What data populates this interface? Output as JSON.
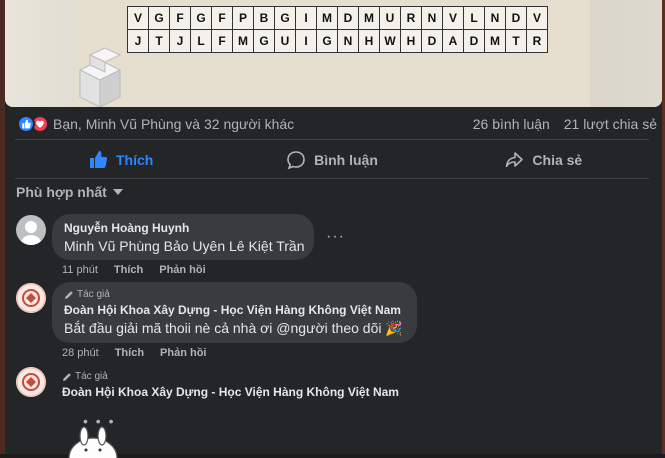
{
  "post": {
    "puzzle_rows": [
      [
        "V",
        "G",
        "F",
        "G",
        "F",
        "P",
        "B",
        "G",
        "I",
        "M",
        "D",
        "M",
        "U",
        "R",
        "N",
        "V",
        "L",
        "N",
        "D",
        "V"
      ],
      [
        "J",
        "T",
        "J",
        "L",
        "F",
        "M",
        "G",
        "U",
        "I",
        "G",
        "N",
        "H",
        "W",
        "H",
        "D",
        "A",
        "D",
        "M",
        "T",
        "R"
      ]
    ]
  },
  "reactions": {
    "summary": "Bạn, Minh Vũ Phùng và 32 người khác",
    "comments_count": "26 bình luận",
    "shares_count": "21 lượt chia sẻ",
    "icons": [
      "like-icon",
      "love-icon"
    ]
  },
  "actions": {
    "like_label": "Thích",
    "comment_label": "Bình luận",
    "share_label": "Chia sẻ",
    "like_active_color": "#2d88ff"
  },
  "sort": {
    "label": "Phù hợp nhất"
  },
  "comments": [
    {
      "author": "Nguyễn Hoàng Huynh",
      "text": "Minh Vũ Phùng Bảo Uyên Lê Kiệt Trần",
      "time": "11 phút",
      "like_label": "Thích",
      "reply_label": "Phản hồi",
      "more": "···"
    },
    {
      "badge": "Tác giả",
      "author": "Đoàn Hội Khoa Xây Dựng - Học Viện Hàng Không Việt Nam",
      "text": "Bắt đầu giải mã thoii nè cả nhà ơi @người theo dõi 🎉",
      "time": "28 phút",
      "like_label": "Thích",
      "reply_label": "Phản hồi"
    },
    {
      "badge": "Tác giả",
      "author": "Đoàn Hội Khoa Xây Dựng - Học Viện Hàng Không Việt Nam",
      "typing": "• • •"
    }
  ]
}
